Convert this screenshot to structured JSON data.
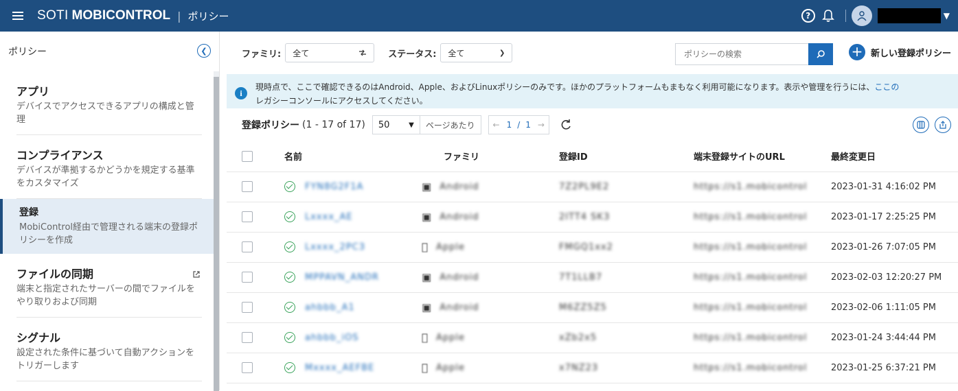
{
  "header": {
    "brand_light": "SOTI",
    "brand_bold": "MOBICONTROL",
    "separator": "|",
    "section": "ポリシー"
  },
  "sidebar": {
    "heading": "ポリシー",
    "items": [
      {
        "title": "アプリ",
        "desc": "デバイスでアクセスできるアプリの構成と管理"
      },
      {
        "title": "コンプライアンス",
        "desc": "デバイスが準拠するかどうかを規定する基準をカスタマイズ"
      },
      {
        "title": "登録",
        "desc": "MobiControl経由で管理される端末の登録ポリシーを作成"
      },
      {
        "title": "ファイルの同期",
        "desc": "端末と指定されたサーバーの間でファイルをやり取りおよび同期"
      },
      {
        "title": "シグナル",
        "desc": "設定された条件に基づいて自動アクションをトリガーします"
      }
    ]
  },
  "filters": {
    "family_label": "ファミリ:",
    "family_value": "全て",
    "status_label": "ステータス:",
    "status_value": "全て",
    "search_placeholder": "ポリシーの検索",
    "new_button": "新しい登録ポリシー"
  },
  "banner": {
    "text": "現時点で、ここで確認できるのはAndroid、Apple、およびLinuxポリシーのみです。ほかのプラットフォームもまもなく利用可能になります。表示や管理を行うには、",
    "link": "ここの",
    "text2": "レガシーコンソールにアクセスしてください。"
  },
  "listbar": {
    "title": "登録ポリシー",
    "count": "(1 - 17 of 17)",
    "per_page": "50",
    "per_page_label": "ページあたり",
    "page_current": "1",
    "page_sep": "/",
    "page_total": "1"
  },
  "table": {
    "headers": [
      "名前",
      "ファミリ",
      "登録ID",
      "端末登録サイトのURL",
      "最終変更日"
    ],
    "rows": [
      {
        "name": "FYN8G2F1A",
        "family": "Android",
        "id": "7Z2PL9E2",
        "url": "https://s1.mobicontrol",
        "date": "2023-01-31 4:16:02 PM"
      },
      {
        "name": "Lxxxx_AE",
        "family": "Android",
        "id": "2ITT4 SK3",
        "url": "https://s1.mobicontrol",
        "date": "2023-01-17 2:25:25 PM"
      },
      {
        "name": "Lxxxx_2PC3",
        "family": "Apple",
        "id": "FMGQ1xx2",
        "url": "https://s1.mobicontrol",
        "date": "2023-01-26 7:07:05 PM"
      },
      {
        "name": "MPPAVN_ANDR",
        "family": "Android",
        "id": "7T1LLB7",
        "url": "https://s1.mobicontrol",
        "date": "2023-02-03 12:20:27 PM"
      },
      {
        "name": "ahbbb_A1",
        "family": "Android",
        "id": "M6ZZ5Z5",
        "url": "https://s1.mobicontrol",
        "date": "2023-02-06 1:11:05 PM"
      },
      {
        "name": "ahbbb_iOS",
        "family": "Apple",
        "id": "xZb2x5",
        "url": "https://s1.mobicontrol",
        "date": "2023-01-24 3:44:44 PM"
      },
      {
        "name": "Mxxxx_AEFBE",
        "family": "Apple",
        "id": "x7NZ23",
        "url": "https://s1.mobicontrol",
        "date": "2023-01-25 6:37:21 PM"
      }
    ]
  },
  "colors": {
    "topbar": "#1e4e80",
    "accent": "#1e6bb8",
    "banner_bg": "#e3f2f8",
    "active_item_bg": "#e3ecf5",
    "status_ok": "#3aa35b"
  }
}
